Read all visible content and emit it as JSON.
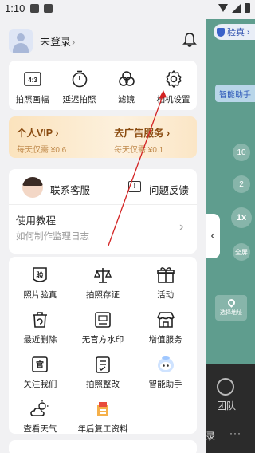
{
  "status_bar": {
    "time": "1:10"
  },
  "user": {
    "name": "未登录",
    "chevron": "›"
  },
  "tools": [
    {
      "label": "拍照画幅",
      "icon": "aspect-ratio-icon",
      "ratio_text": "4:3"
    },
    {
      "label": "延迟拍照",
      "icon": "timer-icon"
    },
    {
      "label": "滤镜",
      "icon": "filter-icon"
    },
    {
      "label": "相机设置",
      "icon": "gear-icon"
    }
  ],
  "vip": {
    "left_title": "个人VIP ›",
    "left_sub": "每天仅需 ¥0.6",
    "right_title": "去广告服务 ›",
    "right_sub": "每天仅需 ¥0.1"
  },
  "support": {
    "service_label": "联系客服",
    "feedback_label": "问题反馈",
    "feedback_icon_text": "!"
  },
  "tutorial": {
    "title": "使用教程",
    "subtitle": "如何制作监理日志",
    "chevron": "›"
  },
  "grid_items": [
    {
      "label": "照片验真",
      "icon": "verify-icon",
      "icon_text": "验"
    },
    {
      "label": "拍照存证",
      "icon": "scale-icon"
    },
    {
      "label": "活动",
      "icon": "gift-icon"
    },
    {
      "label": "最近删除",
      "icon": "trash-icon"
    },
    {
      "label": "无官方水印",
      "icon": "no-watermark-icon"
    },
    {
      "label": "增值服务",
      "icon": "store-icon"
    },
    {
      "label": "关注我们",
      "icon": "follow-icon",
      "icon_text": "官"
    },
    {
      "label": "拍照整改",
      "icon": "rectify-icon"
    },
    {
      "label": "智能助手",
      "icon": "assistant-robot-icon"
    },
    {
      "label": "查看天气",
      "icon": "weather-icon"
    },
    {
      "label": "年后复工资料",
      "icon": "document-bundle-icon"
    }
  ],
  "right_panel": {
    "verify_label": "验真 ›",
    "assistant_label": "智能助手",
    "circle_10": "10",
    "circle_2": "2",
    "zoom_label": "1x",
    "full_label": "全屏",
    "handle_chevron": "‹",
    "address_label": "选择地址",
    "team_label": "团队",
    "record_label": "录",
    "more_label": "···"
  },
  "colors": {
    "accent_red": "#d32222",
    "vip_brown": "#8a4b10",
    "camera_green": "#5f9d8e"
  }
}
